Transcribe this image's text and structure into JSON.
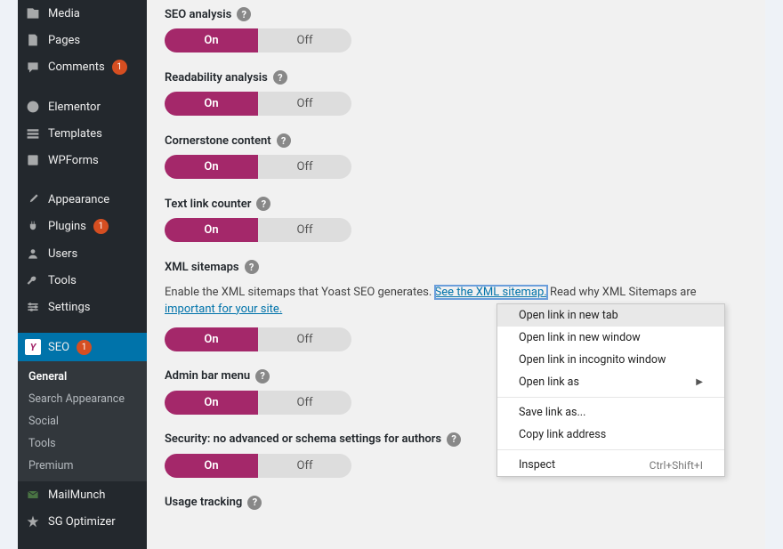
{
  "sidebar": {
    "items": [
      {
        "label": "Media"
      },
      {
        "label": "Pages"
      },
      {
        "label": "Comments",
        "badge": "1"
      },
      {
        "label": "Elementor"
      },
      {
        "label": "Templates"
      },
      {
        "label": "WPForms"
      },
      {
        "label": "Appearance"
      },
      {
        "label": "Plugins",
        "badge": "1"
      },
      {
        "label": "Users"
      },
      {
        "label": "Tools"
      },
      {
        "label": "Settings"
      },
      {
        "label": "SEO",
        "badge": "1"
      },
      {
        "label": "MailMunch"
      },
      {
        "label": "SG Optimizer"
      }
    ],
    "submenu": [
      "General",
      "Search Appearance",
      "Social",
      "Tools",
      "Premium"
    ]
  },
  "toggle": {
    "on": "On",
    "off": "Off"
  },
  "settings": [
    {
      "label": "SEO analysis"
    },
    {
      "label": "Readability analysis"
    },
    {
      "label": "Cornerstone content"
    },
    {
      "label": "Text link counter"
    },
    {
      "label": "XML sitemaps",
      "desc1": "Enable the XML sitemaps that Yoast SEO generates. ",
      "link1": "See the XML sitemap.",
      "desc2": " Read why XML Sitemaps are",
      "link2": "important for your site."
    },
    {
      "label": "Admin bar menu"
    },
    {
      "label": "Security: no advanced or schema settings for authors"
    },
    {
      "label": "Usage tracking"
    }
  ],
  "contextmenu": [
    "Open link in new tab",
    "Open link in new window",
    "Open link in incognito window",
    "Open link as",
    "Save link as...",
    "Copy link address",
    "Inspect"
  ],
  "contextmenu_shortcut": "Ctrl+Shift+I"
}
